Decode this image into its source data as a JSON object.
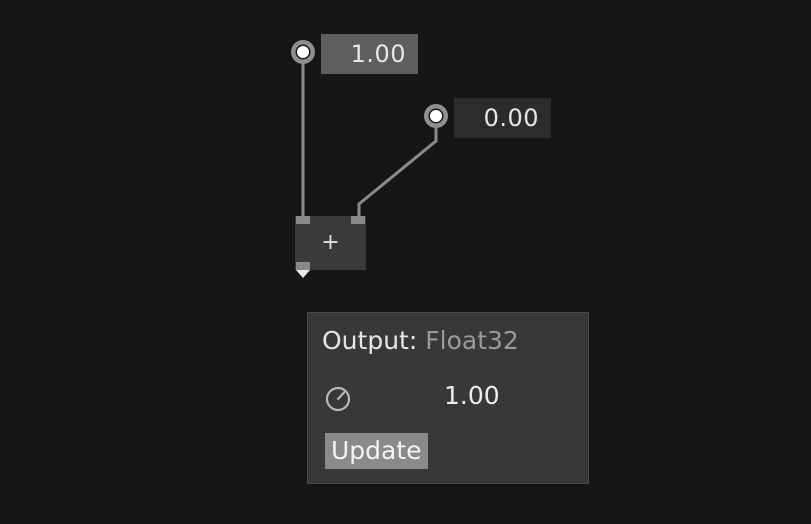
{
  "inputs": [
    {
      "value": "1.00"
    },
    {
      "value": "0.00"
    }
  ],
  "node": {
    "operator": "+"
  },
  "inspector": {
    "output_label": "Output:",
    "output_type": "Float32",
    "value": "1.00",
    "update_label": "Update",
    "gauge_icon": "gauge-icon"
  },
  "colors": {
    "background": "#161616",
    "wire": "#8a8a8a",
    "panel": "#383838",
    "button": "#8a8a8a"
  }
}
